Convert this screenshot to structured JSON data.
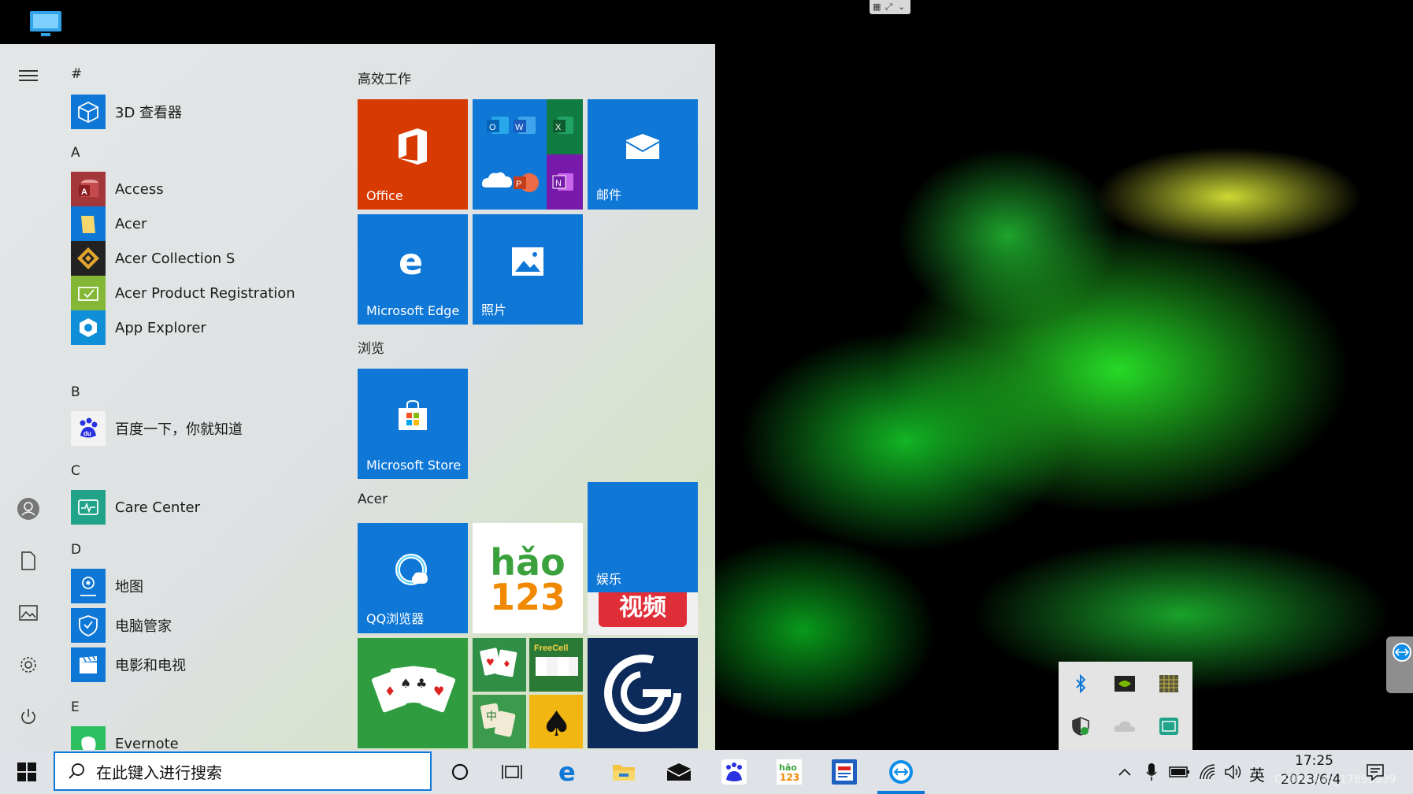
{
  "start_menu": {
    "letters": [
      "#",
      "A",
      "B",
      "C",
      "D",
      "E"
    ],
    "apps": {
      "viewer3d": "3D 查看器",
      "access": "Access",
      "acer": "Acer",
      "acer_collection": "Acer Collection S",
      "acer_reg": "Acer Product Registration",
      "app_explorer": "App Explorer",
      "baidu": "百度一下，你就知道",
      "care_center": "Care Center",
      "maps": "地图",
      "pc_manager": "电脑管家",
      "movies": "电影和电视",
      "evernote": "Evernote"
    },
    "groups": {
      "productivity": "高效工作",
      "browse": "浏览",
      "acer": "Acer"
    },
    "tiles": {
      "office": "Office",
      "mail": "邮件",
      "edge": "Microsoft Edge",
      "photos": "照片",
      "store": "Microsoft Store",
      "qq_browser": "QQ浏览器",
      "entertainment": "娱乐",
      "hao123": "hǎo123",
      "video": "视频"
    }
  },
  "taskbar": {
    "search_placeholder": "在此键入进行搜索",
    "ime": "英",
    "time": "17:25",
    "date": "2023/6/4",
    "watermark": "CSDN @qq_17853939"
  },
  "colors": {
    "accent": "#0f78d7",
    "office_red": "#d83b01",
    "taskbar_bg": "#dfe3e7",
    "start_bg": "#e4e7e8"
  },
  "icons": [
    "windows-icon",
    "search-icon",
    "cortana-icon",
    "task-view-icon",
    "edge-icon",
    "file-explorer-icon",
    "mail-icon",
    "baidu-icon",
    "hao123-icon",
    "news-icon",
    "teamviewer-icon",
    "chevron-up-icon",
    "mic-icon",
    "battery-icon",
    "wifi-icon",
    "volume-icon",
    "notification-icon"
  ]
}
